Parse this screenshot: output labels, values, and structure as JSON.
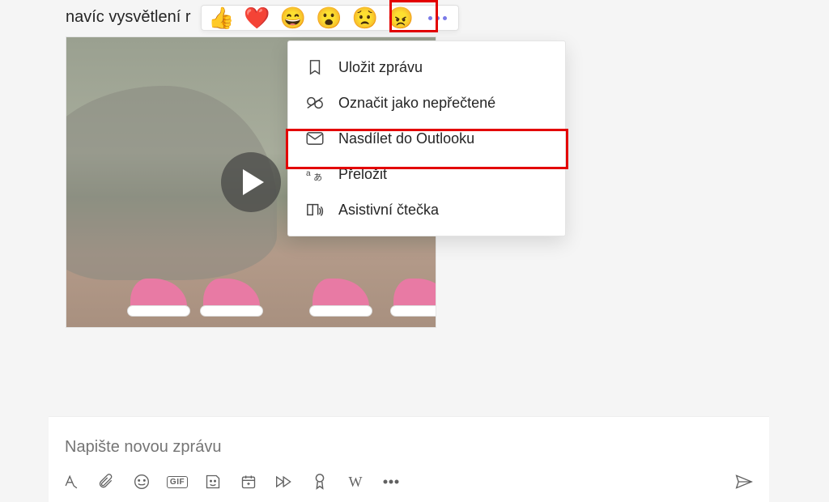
{
  "message": {
    "text_fragment": "navíc vysvětlení r"
  },
  "reactions": {
    "items": [
      {
        "name": "thumbs-up",
        "glyph": "👍"
      },
      {
        "name": "heart",
        "glyph": "❤️"
      },
      {
        "name": "laugh",
        "glyph": "😄"
      },
      {
        "name": "surprised",
        "glyph": "😮"
      },
      {
        "name": "sad",
        "glyph": "😟"
      },
      {
        "name": "angry",
        "glyph": "😠"
      }
    ],
    "more_label": "Více možností"
  },
  "context_menu": {
    "items": [
      {
        "icon": "bookmark",
        "label": "Uložit zprávu"
      },
      {
        "icon": "unread",
        "label": "Označit jako nepřečtené"
      },
      {
        "icon": "envelope",
        "label": "Nasdílet do Outlooku",
        "highlighted": true
      },
      {
        "icon": "translate",
        "label": "Přeložit"
      },
      {
        "icon": "immersive-reader",
        "label": "Asistivní čtečka"
      }
    ]
  },
  "compose": {
    "placeholder": "Napište novou zprávu",
    "toolbar": {
      "format": "format",
      "attach": "attach",
      "emoji": "emoji",
      "gif": "GIF",
      "sticker": "sticker",
      "meeting": "meeting",
      "stream": "stream",
      "praise": "praise",
      "wiki": "W",
      "more": "more",
      "send": "send"
    }
  },
  "highlights": {
    "more_button": true,
    "share_outlook": true
  }
}
